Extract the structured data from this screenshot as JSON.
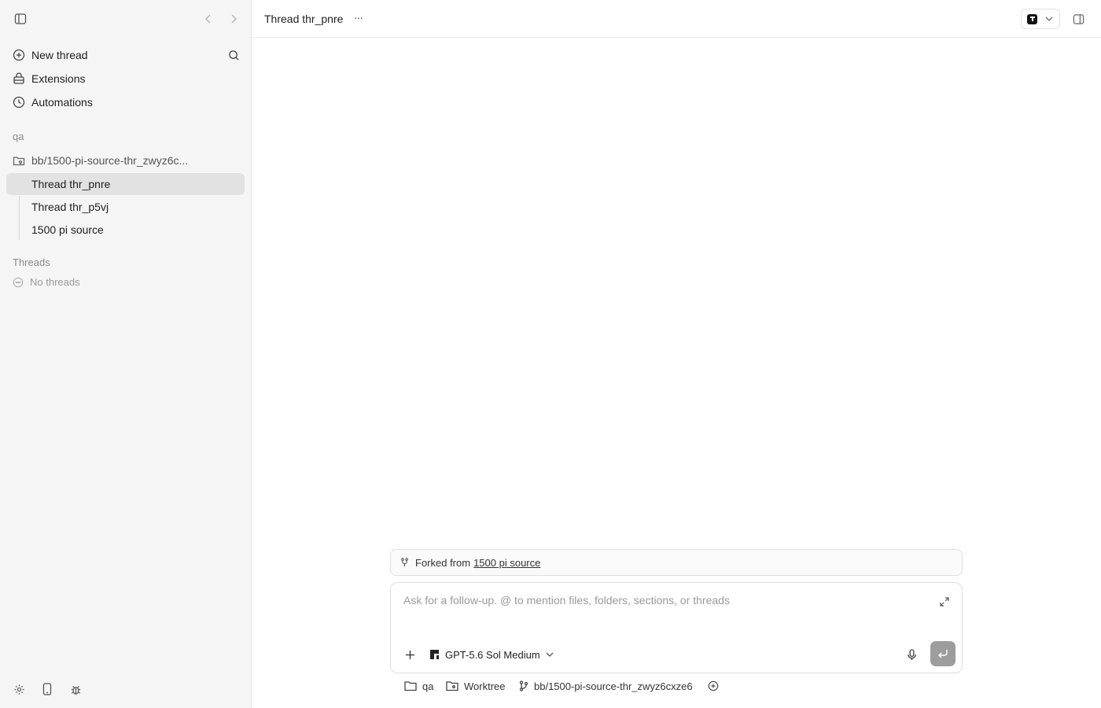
{
  "sidebar": {
    "nav": [
      {
        "label": "New thread",
        "icon": "plus-circle-icon"
      },
      {
        "label": "Extensions",
        "icon": "puzzle-icon"
      },
      {
        "label": "Automations",
        "icon": "clock-icon"
      }
    ],
    "project_label": "qa",
    "worktree_label": "bb/1500-pi-source-thr_zwyz6c...",
    "threads": [
      {
        "label": "Thread thr_pnre",
        "active": true
      },
      {
        "label": "Thread thr_p5vj",
        "active": false
      },
      {
        "label": "1500 pi source",
        "active": false
      }
    ],
    "threads_section_label": "Threads",
    "no_threads_label": "No threads"
  },
  "header": {
    "title": "Thread thr_pnre",
    "more_label": "···"
  },
  "fork_bar": {
    "prefix": "Forked from",
    "link_label": "1500 pi source"
  },
  "composer": {
    "placeholder": "Ask for a follow-up. @ to mention files, folders, sections, or threads",
    "model_label": "GPT-5.6 Sol Medium"
  },
  "footer": {
    "project": "qa",
    "mode": "Worktree",
    "branch": "bb/1500-pi-source-thr_zwyz6cxze6"
  },
  "colors": {
    "sidebar_bg": "#f5f5f5",
    "active_item_bg": "#e2e2e2",
    "send_button_bg": "#9d9d9d"
  }
}
